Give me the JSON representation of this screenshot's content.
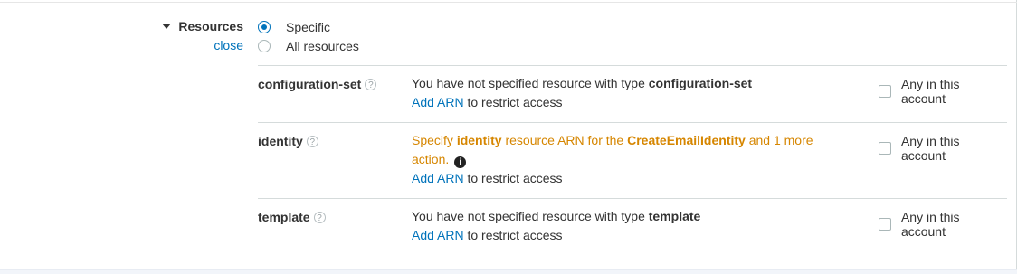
{
  "resources": {
    "title": "Resources",
    "close": "close",
    "options": [
      {
        "label": "Specific",
        "checked": true
      },
      {
        "label": "All resources",
        "checked": false
      }
    ],
    "help_icon": "question-circle-icon",
    "info_icon": "info-circle-icon",
    "rows": [
      {
        "name": "configuration-set",
        "desc_prefix": "You have not specified resource with type ",
        "desc_type": "configuration-set",
        "add_arn": "Add ARN",
        "restrict": " to restrict access",
        "any": "Any in this account"
      },
      {
        "name": "identity",
        "warn_1": "Specify ",
        "warn_type": "identity",
        "warn_2": " resource ARN for the ",
        "warn_action": "CreateEmailIdentity",
        "warn_3": " and 1 more",
        "warn_4": "action.",
        "add_arn": "Add ARN",
        "restrict": " to restrict access",
        "any": "Any in this account"
      },
      {
        "name": "template",
        "desc_prefix": "You have not specified resource with type ",
        "desc_type": "template",
        "add_arn": "Add ARN",
        "restrict": " to restrict access",
        "any": "Any in this account"
      }
    ]
  },
  "colors": {
    "link": "#0073bb",
    "warning": "#d68600",
    "text": "#333333",
    "separator": "#d5dbdb"
  }
}
